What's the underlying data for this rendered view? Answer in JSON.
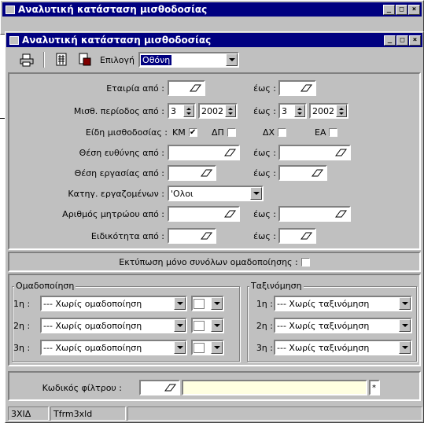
{
  "back_window": {
    "title": "Αναλυτική κατάσταση μισθοδοσίας"
  },
  "window": {
    "title": "Αναλυτική κατάσταση μισθοδοσίας",
    "min": "_",
    "max": "□",
    "close": "×"
  },
  "toolbar": {
    "output_label": "Επιλογή",
    "output_value": "Οθόνη"
  },
  "form": {
    "company_from": "Εταιρία από :",
    "to": "έως :",
    "period_from": "Μισθ. περίοδος από :",
    "period_from_month": "3",
    "period_from_year": "2002",
    "period_to_month": "3",
    "period_to_year": "2002",
    "payroll_types": "Είδη μισθοδοσίας :",
    "types": [
      "ΚΜ",
      "ΔΠ",
      "ΔΧ",
      "ΕΑ"
    ],
    "types_checked": [
      true,
      false,
      false,
      false
    ],
    "position_from": "Θέση ευθύνης από :",
    "workplace_from": "Θέση εργασίας από :",
    "employee_category": "Κατηγ. εργαζομένων :",
    "employee_category_value": "'Ολοι",
    "reg_number_from": "Αριθμός μητρώου από :",
    "specialty_from": "Ειδικότητα από :"
  },
  "totals_only": {
    "label": "Εκτύπωση μόνο συνόλων ομαδοποίησης :"
  },
  "grouping": {
    "title": "Ομαδοποίηση",
    "rows": [
      {
        "label": "1η :",
        "value": "--- Χωρίς ομαδοποίηση"
      },
      {
        "label": "2η :",
        "value": "--- Χωρίς ομαδοποίηση"
      },
      {
        "label": "3η :",
        "value": "--- Χωρίς ομαδοποίηση"
      }
    ]
  },
  "sorting": {
    "title": "Ταξινόμηση",
    "rows": [
      {
        "label": "1η :",
        "value": "--- Χωρίς ταξινόμηση"
      },
      {
        "label": "2η :",
        "value": "--- Χωρίς ταξινόμηση"
      },
      {
        "label": "3η :",
        "value": "--- Χωρίς ταξινόμηση"
      }
    ]
  },
  "filter": {
    "label": "Κωδικός φίλτρου :",
    "star": "*"
  },
  "status": {
    "panel1": "3XIΔ",
    "panel2": "Tfrm3xld",
    "panel3": ""
  },
  "colors": {
    "titlebar": "#000080",
    "face": "#c0c0c0",
    "filter_bg": "#ffffe1"
  }
}
